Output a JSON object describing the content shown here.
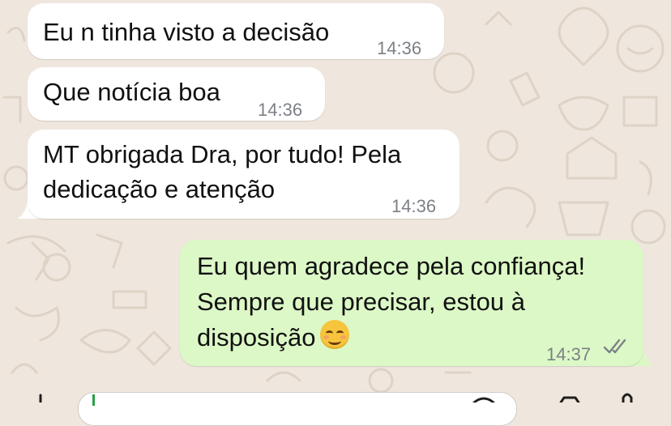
{
  "messages": [
    {
      "direction": "incoming",
      "lines": [
        "Eu n tinha visto a decisão"
      ],
      "time": "14:36"
    },
    {
      "direction": "incoming",
      "lines": [
        "Que notícia boa"
      ],
      "time": "14:36"
    },
    {
      "direction": "incoming",
      "lines": [
        "MT obrigada Dra, por tudo! Pela",
        "dedicação e atenção"
      ],
      "time": "14:36"
    },
    {
      "direction": "outgoing",
      "lines": [
        "Eu quem agradece pela confiança!",
        "Sempre que precisar, estou à",
        "disposição"
      ],
      "emoji": "smiling-face-icon",
      "time": "14:37",
      "status": "read"
    }
  ],
  "colors": {
    "background": "#efe7de",
    "incoming_bubble": "#ffffff",
    "outgoing_bubble": "#dcf8c6",
    "timestamp": "#7c8186",
    "read_ticks": "#7c8186",
    "input_cursor": "#25a244"
  },
  "input_bar": {
    "icons": [
      "plus-icon",
      "sticker-icon",
      "camera-icon",
      "microphone-icon"
    ]
  }
}
